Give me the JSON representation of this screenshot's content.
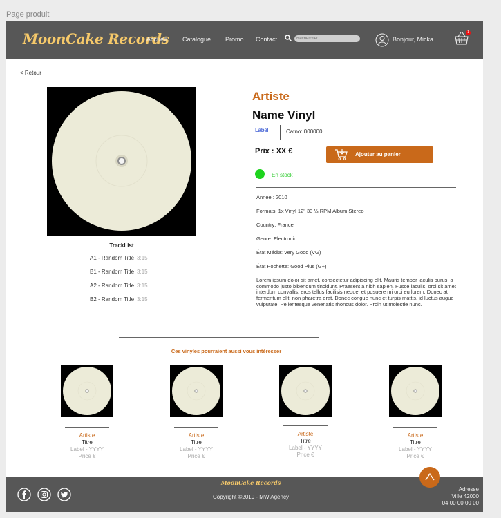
{
  "page_caption": "Page produit",
  "header": {
    "logo": "MoonCake Records",
    "nav": [
      "Accueil",
      "Catalogue",
      "Promo",
      "Contact"
    ],
    "search_placeholder": "Rechercher...",
    "greeting": "Bonjour, Micka",
    "cart_count": "1"
  },
  "back_link": "< Retour",
  "product": {
    "artist": "Artiste",
    "name": "Name Vinyl",
    "label": "Label",
    "catno": "Catno: 000000",
    "price": "Prix : XX €",
    "add_to_cart": "Ajouter au panier",
    "stock": "En stock",
    "specs": [
      "Année : 2010",
      "Formats: 1x Vinyl 12\" 33 ⅓ RPM Album Stereo",
      "Country: France",
      "Genre: Electronic",
      "État Média: Very Good (VG)",
      "État Pochette: Good Plus (G+)"
    ],
    "description": "Lorem ipsum dolor sit amet, consectetur adipiscing elit. Mauris tempor iaculis purus, a commodo justo bibendum tincidunt. Praesent a nibh sapien. Fusce iaculis, orci sit amet interdum convallis, eros tellus facilisis neque, et posuere mi orci eu lorem. Donec at fermentum elit, non pharetra erat. Donec congue nunc et turpis mattis, id luctus augue vulputate. Pellentesque venenatis rhoncus dolor. Proin ut molestie nunc."
  },
  "tracklist": {
    "title": "TrackList",
    "tracks": [
      {
        "title": "A1 - Random Title",
        "duration": "3:15"
      },
      {
        "title": "B1 - Random Title",
        "duration": "3:15"
      },
      {
        "title": "A2 - Random Title",
        "duration": "3:15"
      },
      {
        "title": "B2 - Random Title",
        "duration": "3:15"
      }
    ]
  },
  "suggestions": {
    "title": "Ces vinyles pourraient aussi vous intéresser",
    "items": [
      {
        "artist": "Artiste",
        "title": "Titre",
        "label": "Label - YYYY",
        "price": "Price €"
      },
      {
        "artist": "Artiste",
        "title": "Titre",
        "label": "Label - YYYY",
        "price": "Price €"
      },
      {
        "artist": "Artiste",
        "title": "Titre",
        "label": "Label - YYYY",
        "price": "Price €"
      },
      {
        "artist": "Artiste",
        "title": "Titre",
        "label": "Label - YYYY",
        "price": "Price €"
      }
    ]
  },
  "footer": {
    "logo": "MoonCake Records",
    "copyright": "Copyright ©2019 - MW Agency",
    "address": [
      "Adresse",
      "Ville 42000",
      "04 00 00 00 00"
    ],
    "social": [
      "facebook-icon",
      "instagram-icon",
      "twitter-icon"
    ]
  },
  "colors": {
    "accent": "#c9691a",
    "header_bg": "#575757",
    "logo": "#f6c96a",
    "stock": "#1ed41e"
  }
}
